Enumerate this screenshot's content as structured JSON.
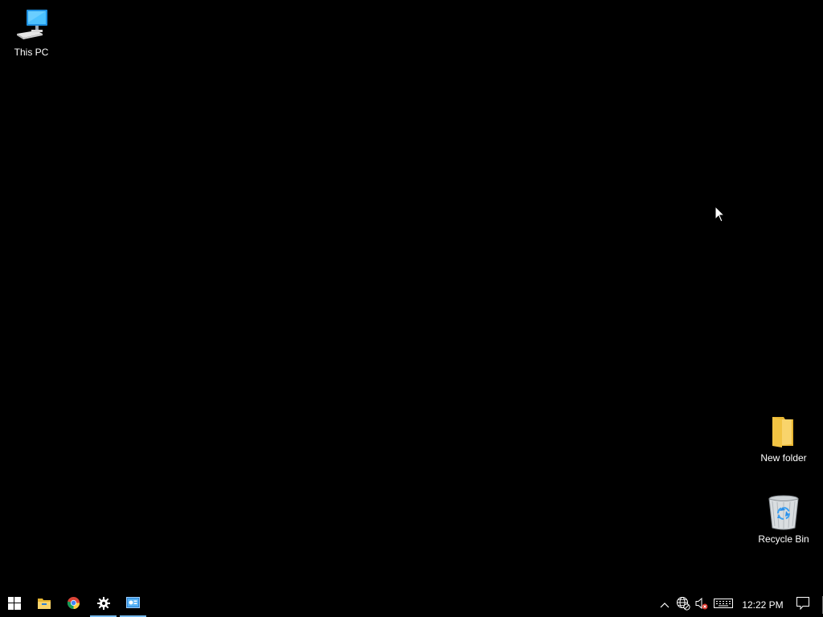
{
  "desktop": {
    "background_color": "#000000",
    "icons": [
      {
        "label": "This PC",
        "icon": "computer-icon"
      },
      {
        "label": "New folder",
        "icon": "folder-icon"
      },
      {
        "label": "Recycle Bin",
        "icon": "recycle-bin-icon"
      }
    ]
  },
  "taskbar": {
    "start": {
      "icon": "windows-logo-icon"
    },
    "pinned": [
      {
        "icon": "file-explorer-icon",
        "active": false
      },
      {
        "icon": "chrome-icon",
        "active": false
      },
      {
        "icon": "settings-gear-icon",
        "active": true
      },
      {
        "icon": "control-panel-icon",
        "active": true
      }
    ],
    "accent_color": "#76b9ed",
    "tray": {
      "chevron_icon": "chevron-up-icon",
      "network_icon": "globe-network-icon",
      "volume_icon": "volume-muted-icon",
      "keyboard_icon": "touch-keyboard-icon",
      "clock": "12:22 PM",
      "notification_icon": "action-center-icon"
    }
  }
}
